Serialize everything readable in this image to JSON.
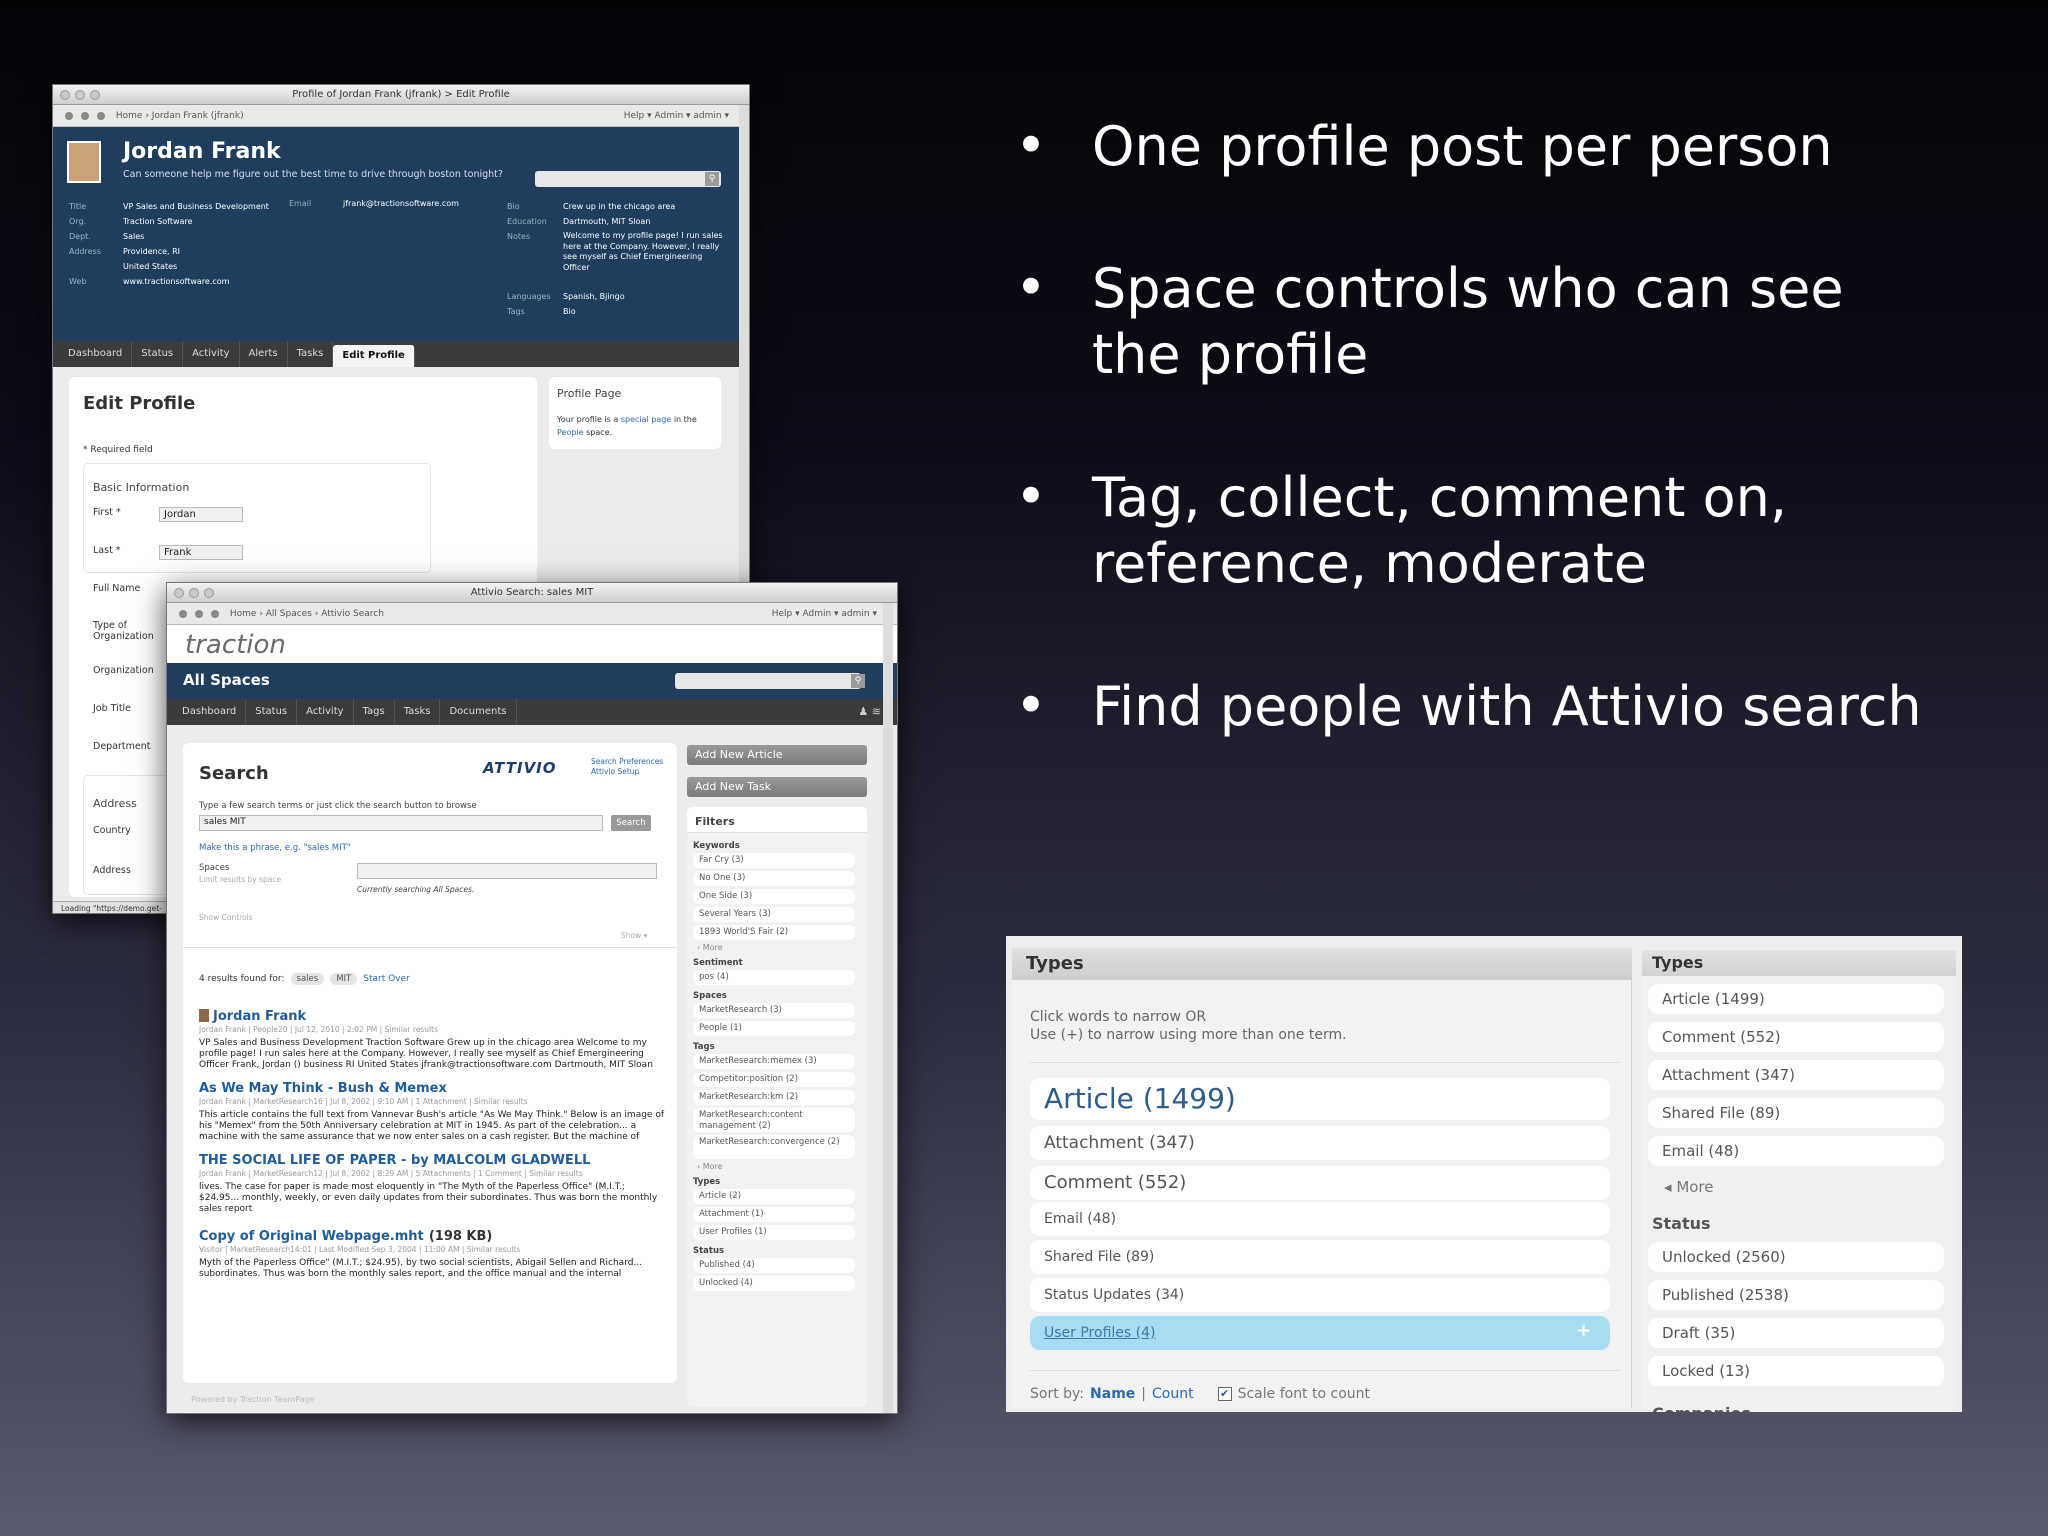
{
  "slide": {
    "bullets": [
      "One profile post per person",
      "Space controls who can see the profile",
      "Tag, collect, comment on, reference, moderate",
      "Find people with Attivio search"
    ],
    "bullet_glyph": "•"
  },
  "profile_window": {
    "title": "Profile of Jordan Frank (jfrank) > Edit Profile",
    "breadcrumb": "Home › Jordan Frank (jfrank)",
    "top_links": "Help ▾   Admin ▾   admin ▾",
    "name": "Jordan Frank",
    "status": "Can someone help me figure out the best time to drive through boston tonight?",
    "fields_left": [
      {
        "label": "Title",
        "value": "VP Sales and Business Development"
      },
      {
        "label": "Org.",
        "value": "Traction Software"
      },
      {
        "label": "Dept.",
        "value": "Sales"
      },
      {
        "label": "Address",
        "value": "Providence, RI"
      },
      {
        "label": "",
        "value": "United States"
      },
      {
        "label": "Web",
        "value": "www.tractionsoftware.com"
      }
    ],
    "email_label": "Email",
    "email_value": "jfrank@tractionsoftware.com",
    "fields_right": [
      {
        "label": "Bio",
        "value": "Crew up in the chicago area"
      },
      {
        "label": "Education",
        "value": "Dartmouth, MIT Sloan"
      },
      {
        "label": "Notes",
        "value": "Welcome to my profile page! I run sales here at the Company. However, I really see myself as Chief Emergineering Officer"
      },
      {
        "label": "Languages",
        "value": "Spanish, Bjingo"
      },
      {
        "label": "Tags",
        "value": "Bio"
      }
    ],
    "tabs": [
      "Dashboard",
      "Status",
      "Activity",
      "Alerts",
      "Tasks",
      "Edit Profile"
    ],
    "edit_title": "Edit Profile",
    "required_note": "* Required field",
    "basic_info": "Basic Information",
    "form": [
      {
        "label": "First *",
        "value": "Jordan"
      },
      {
        "label": "Last *",
        "value": "Frank"
      },
      {
        "label": "Full Name",
        "value": ""
      },
      {
        "label": "Type of Organization",
        "value": ""
      },
      {
        "label": "Organization",
        "value": ""
      },
      {
        "label": "Job Title",
        "value": ""
      },
      {
        "label": "Department",
        "value": ""
      }
    ],
    "address_title": "Address",
    "country_label": "Country",
    "address_label": "Address",
    "profile_page_title": "Profile Page",
    "profile_page_text_1": "Your profile is a",
    "profile_page_link": "special page",
    "profile_page_text_2": "in the",
    "profile_page_space": "People",
    "profile_page_text_3": "space.",
    "status_bar": "Loading \"https://demo.get-"
  },
  "search_window": {
    "title": "Attivio Search: sales MIT",
    "breadcrumb": "Home › All Spaces › Attivio Search",
    "top_links": "Help ▾   Admin ▾   admin ▾",
    "logo": "traction",
    "space": "All Spaces",
    "tabs": [
      "Dashboard",
      "Status",
      "Activity",
      "Tags",
      "Tasks",
      "Documents"
    ],
    "search_title": "Search",
    "attivio_logo": "ATTIVIO",
    "attivio_links": [
      "Search Preferences",
      "Attivio Setup"
    ],
    "hint": "Type a few search terms or just click the search button to browse",
    "query": "sales MIT",
    "search_button": "Search",
    "phrase_link": "Make this a phrase, e.g. \"sales MIT\"",
    "spaces_label": "Spaces",
    "spaces_sub": "Limit results by space",
    "currently": "Currently searching All Spaces.",
    "show_controls": "Show Controls",
    "show": "Show ▾",
    "results_found": "4 results found for:",
    "chips": [
      "sales",
      "MIT"
    ],
    "start_over": "Start Over",
    "results": [
      {
        "title": "Jordan Frank",
        "meta": "Jordan Frank | People20 | Jul 12, 2010 | 2:02 PM | Similar results",
        "body": "VP Sales and Business Development Traction Software Grew up in the chicago area Welcome to my profile page! I run sales here at the Company. However, I really see myself as Chief Emergineering Officer Frank, Jordan () business RI United States jfrank@tractionsoftware.com Dartmouth, MIT Sloan"
      },
      {
        "title": "As We May Think - Bush & Memex",
        "meta": "Jordan Frank | MarketResearch16 | Jul 8, 2002 | 9:10 AM | 1 Attachment | Similar results",
        "body": "This article contains the full text from Vannevar Bush's article \"As We May Think.\" Below is an image of his \"Memex\" from the 50th Anniversary celebration at MIT in 1945. As part of the celebration... a machine with the same assurance that we now enter sales on a cash register. But the machine of"
      },
      {
        "title": "THE SOCIAL LIFE OF PAPER - by MALCOLM GLADWELL",
        "meta": "Jordan Frank | MarketResearch12 | Jul 8, 2002 | 8:29 AM | 5 Attachments | 1 Comment | Similar results",
        "body": "lives. The case for paper is made most eloquently in \"The Myth of the Paperless Office\" (M.I.T.; $24.95... monthly, weekly, or even daily updates from their subordinates. Thus was born the monthly sales report"
      },
      {
        "title": "Copy of Original Webpage.mht",
        "size": "(198 KB)",
        "meta": "Visitor | MarketResearch14:01 | Last Modified Sep 3, 2004 | 11:00 AM | Similar results",
        "body": "Myth of the Paperless Office\" (M.I.T.; $24.95), by two social scientists, Abigail Sellen and Richard... subordinates. Thus was born the monthly sales report, and the office manual and the internal"
      }
    ],
    "add_article": "Add New Article",
    "add_task": "Add New Task",
    "filters_title": "Filters",
    "filter_groups": [
      {
        "name": "Keywords",
        "items": [
          "Far Cry (3)",
          "No One (3)",
          "One Side (3)",
          "Several Years (3)",
          "1893 World'S Fair (2)"
        ],
        "more": "More"
      },
      {
        "name": "Sentiment",
        "items": [
          "pos (4)"
        ]
      },
      {
        "name": "Spaces",
        "items": [
          "MarketResearch (3)",
          "People (1)"
        ]
      },
      {
        "name": "Tags",
        "items": [
          "MarketResearch:memex (3)",
          "Competitor:position (2)",
          "MarketResearch:km (2)",
          "MarketResearch:content management (2)",
          "MarketResearch:convergence (2)"
        ],
        "more": "More"
      },
      {
        "name": "Types",
        "items": [
          "Article (2)",
          "Attachment (1)",
          "User Profiles (1)"
        ]
      },
      {
        "name": "Status",
        "items": [
          "Published (4)",
          "Unlocked (4)"
        ]
      }
    ],
    "footer": "Powered by Traction TeamPage"
  },
  "types_panel": {
    "title": "Types",
    "help1": "Click words to narrow OR",
    "help2": "Use (+) to narrow using more than one term.",
    "items": [
      {
        "label": "Article (1499)",
        "size": 28
      },
      {
        "label": "Attachment (347)",
        "size": 17
      },
      {
        "label": "Comment (552)",
        "size": 18
      },
      {
        "label": "Email (48)",
        "size": 14
      },
      {
        "label": "Shared File (89)",
        "size": 14
      },
      {
        "label": "Status Updates (34)",
        "size": 14
      },
      {
        "label": "User Profiles (4)",
        "size": 14
      }
    ],
    "selected_plus": "+",
    "sort_by": "Sort by:",
    "sort_name": "Name",
    "sort_sep": "|",
    "sort_count": "Count",
    "scale_label": "Scale font to count",
    "side_title": "Types",
    "side_items": [
      "Article (1499)",
      "Comment (552)",
      "Attachment (347)",
      "Shared File (89)",
      "Email (48)"
    ],
    "side_more": "More",
    "status_title": "Status",
    "status_items": [
      "Unlocked (2560)",
      "Published (2538)",
      "Draft (35)",
      "Locked (13)"
    ],
    "cut_title": "Companies"
  }
}
